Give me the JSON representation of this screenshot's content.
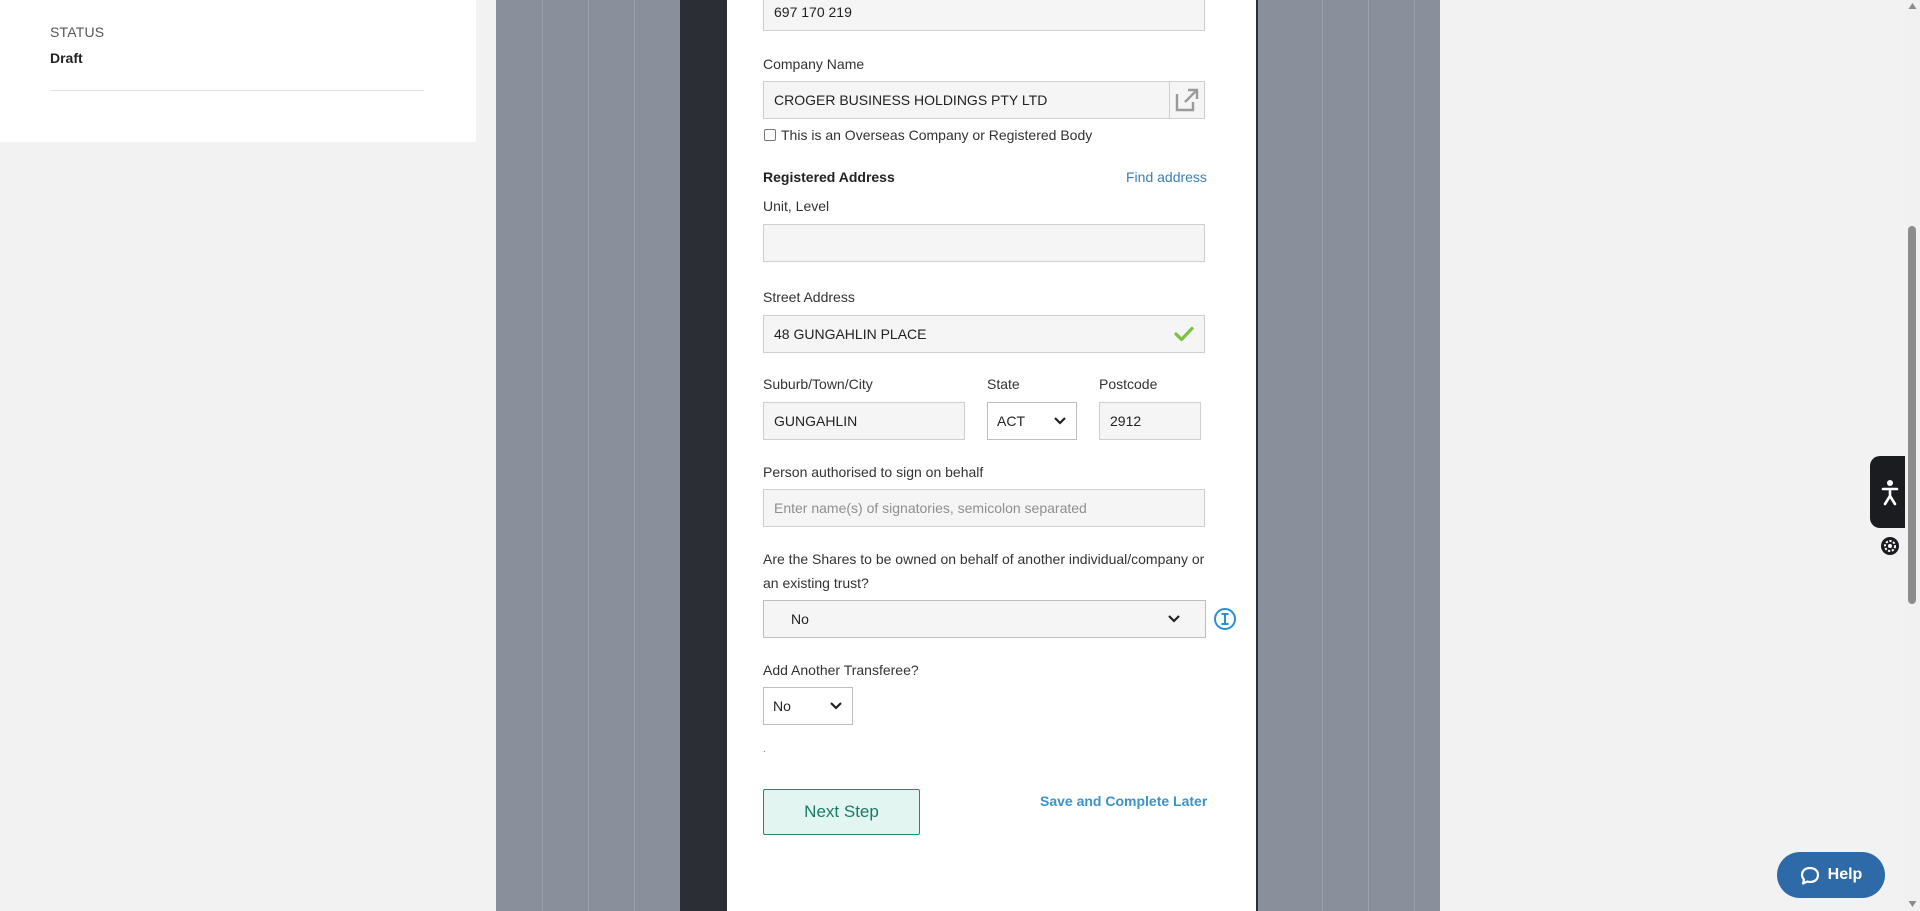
{
  "status": {
    "label": "STATUS",
    "value": "Draft"
  },
  "form": {
    "acn_value": "697 170 219",
    "company_name_label": "Company Name",
    "company_name_value": "CROGER BUSINESS HOLDINGS PTY LTD",
    "overseas_checkbox_label": "This is an Overseas Company or Registered Body",
    "registered_address_heading": "Registered Address",
    "find_address_link": "Find address",
    "unit_level_label": "Unit, Level",
    "unit_level_value": "",
    "street_address_label": "Street Address",
    "street_address_value": "48 GUNGAHLIN PLACE",
    "suburb_label": "Suburb/Town/City",
    "suburb_value": "GUNGAHLIN",
    "state_label": "State",
    "state_value": "ACT",
    "postcode_label": "Postcode",
    "postcode_value": "2912",
    "signatory_label": "Person authorised to sign on behalf",
    "signatory_placeholder": "Enter name(s) of signatories, semicolon separated",
    "shares_question_line1": "Are the Shares to be owned on behalf of another individual/company or",
    "shares_question_line2": "an existing trust?",
    "shares_value": "No",
    "another_transferee_label": "Add Another Transferee?",
    "another_transferee_value": "No",
    "dot": ".",
    "next_step_label": "Next Step",
    "save_later_label": "Save and Complete Later"
  },
  "widgets": {
    "help_label": "Help"
  },
  "colors": {
    "accent_link": "#3a7fb8",
    "next_button_border": "#1e8a78",
    "check_green": "#7dc242",
    "help_bg": "#2f6aa8"
  }
}
